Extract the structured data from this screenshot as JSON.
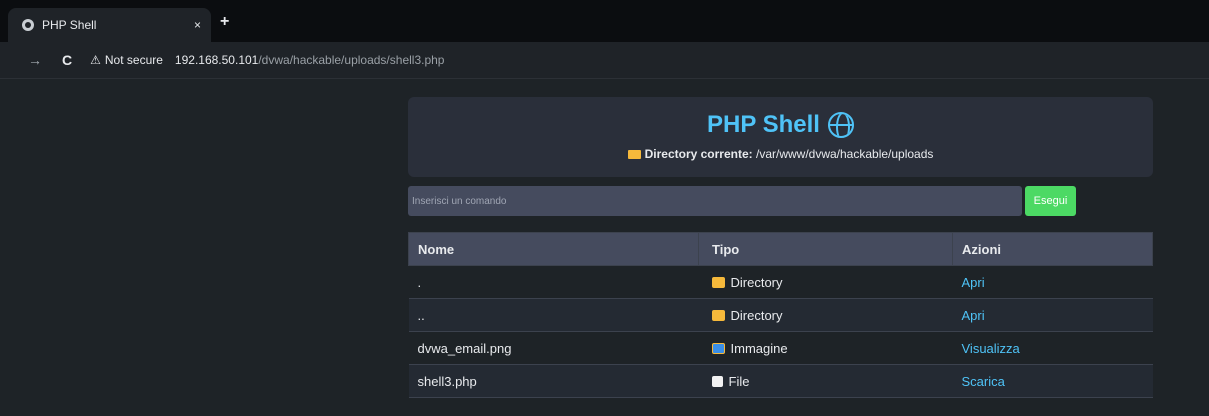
{
  "browser": {
    "tab_title": "PHP Shell",
    "tab_close": "×",
    "new_tab": "+",
    "back": "←",
    "forward": "→",
    "reload": "C",
    "warning_icon": "⚠",
    "security_label": "Not secure",
    "url_host": "192.168.50.101",
    "url_path": "/dvwa/hackable/uploads/shell3.php"
  },
  "header": {
    "title": "PHP Shell",
    "dir_label": "Directory corrente:",
    "dir_path": "/var/www/dvwa/hackable/uploads"
  },
  "command": {
    "placeholder": "Inserisci un comando",
    "value": "",
    "button_label": "Esegui"
  },
  "table": {
    "headers": [
      "Nome",
      "Tipo",
      "Azioni"
    ],
    "rows": [
      {
        "name": ".",
        "type": "Directory",
        "type_icon": "folder-icon",
        "action": "Apri"
      },
      {
        "name": "..",
        "type": "Directory",
        "type_icon": "folder-icon",
        "action": "Apri"
      },
      {
        "name": "dvwa_email.png",
        "type": "Immagine",
        "type_icon": "image-icon",
        "action": "Visualizza"
      },
      {
        "name": "shell3.php",
        "type": "File",
        "type_icon": "file-icon",
        "action": "Scarica"
      }
    ]
  },
  "colors": {
    "accent": "#4fc3f7",
    "run_button": "#4cd964",
    "folder": "#f6b93b"
  }
}
